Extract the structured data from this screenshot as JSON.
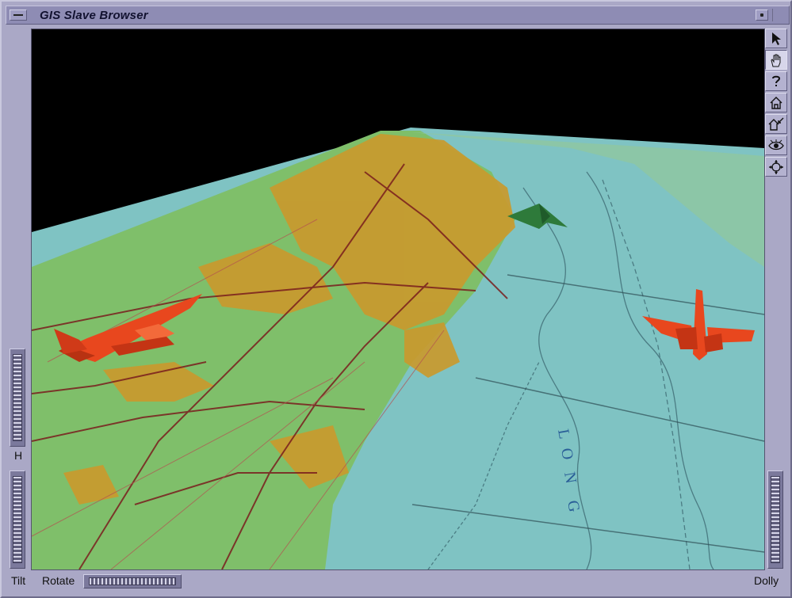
{
  "window": {
    "title": "GIS Slave Browser"
  },
  "viewer": {
    "map_lettering": [
      "L",
      "O",
      "N",
      "G"
    ],
    "objects": [
      "red-jet-left",
      "green-jet-distant",
      "red-jet-right"
    ]
  },
  "toolbar": {
    "buttons": [
      {
        "name": "select-pick-mode",
        "icon": "arrow-pointer-icon"
      },
      {
        "name": "view-mode",
        "icon": "hand-icon",
        "active": true
      },
      {
        "name": "help",
        "icon": "question-mark-icon"
      },
      {
        "name": "home",
        "icon": "home-icon"
      },
      {
        "name": "set-home",
        "icon": "set-home-icon"
      },
      {
        "name": "view-all",
        "icon": "eye-icon"
      },
      {
        "name": "seek",
        "icon": "crosshair-icon"
      }
    ]
  },
  "controls": {
    "h_label": "H",
    "tilt_label": "Tilt",
    "rotate_label": "Rotate",
    "dolly_label": "Dolly"
  },
  "colors": {
    "window_frame": "#aaa8c6",
    "titlebar": "#8e8cb4",
    "ocean": "#7fc3c3",
    "land": "#7fbf6a",
    "urban": "#c99a2e",
    "jet_red": "#e8471e",
    "jet_green": "#2e7a3a"
  }
}
